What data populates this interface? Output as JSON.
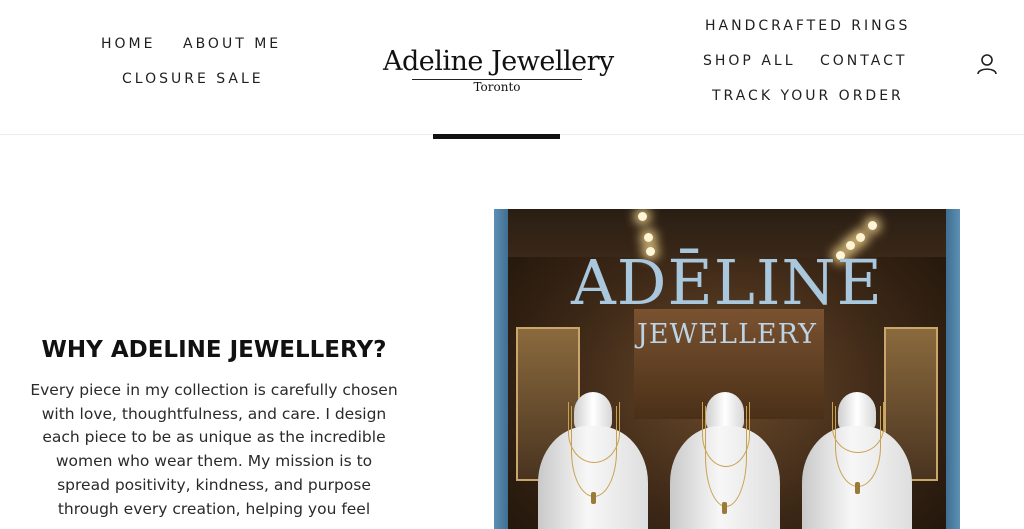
{
  "header": {
    "nav_left": [
      "HOME",
      "ABOUT ME",
      "CLOSURE SALE"
    ],
    "nav_right": [
      "HANDCRAFTED RINGS",
      "SHOP ALL",
      "CONTACT",
      "TRACK YOUR ORDER"
    ],
    "logo_title": "Adeline Jewellery",
    "logo_subtitle": "Toronto",
    "account_icon": "account-icon"
  },
  "main": {
    "heading": "WHY ADELINE JEWELLERY?",
    "body": "Every piece in my collection is carefully chosen with love, thoughtfulness, and care. I design each piece to be as unique as the incredible women who wear them. My mission is to spread positivity, kindness, and purpose through every creation, helping you feel",
    "image": {
      "sign_title": "ADĒLINE",
      "sign_subtitle": "JEWELLERY"
    }
  },
  "colors": {
    "text": "#1f1f1f",
    "frame_blue": "#4f82a6",
    "sign_blue": "#a9c7dd"
  }
}
